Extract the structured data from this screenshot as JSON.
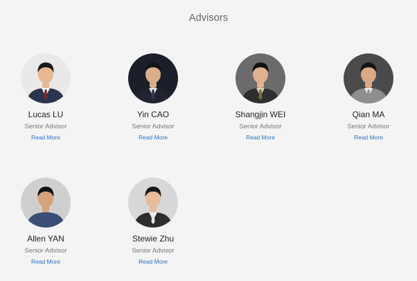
{
  "section": {
    "title": "Advisors"
  },
  "advisors": [
    {
      "name": "Lucas LU",
      "role": "Senior Advisor",
      "link": "Read More",
      "avatar_bg": "#e9e9e9",
      "skin": "#e7b892",
      "hair": "#1b1b1b",
      "suit": "#2a3550",
      "shirt": "#ffffff",
      "tie": "#7a2730"
    },
    {
      "name": "Yin CAO",
      "role": "Senior Advisor",
      "link": "Read More",
      "avatar_bg": "#1b1f2a",
      "skin": "#d9ae8b",
      "hair": "#151515",
      "suit": "#20242f",
      "shirt": "#e6e6e6",
      "tie": "#30384d"
    },
    {
      "name": "Shangjin WEI",
      "role": "Senior Advisor",
      "link": "Read More",
      "avatar_bg": "#6b6b6b",
      "skin": "#e0b18e",
      "hair": "#121212",
      "suit": "#2e2e2e",
      "shirt": "#d9d2b8",
      "tie": "#7a6a3d"
    },
    {
      "name": "Qian MA",
      "role": "Senior Advisor",
      "link": "Read More",
      "avatar_bg": "#4a4a4a",
      "skin": "#d9a985",
      "hair": "#141414",
      "suit": "#8e8e8e",
      "shirt": "#f2f2f2",
      "tie": "#8e8e8e"
    },
    {
      "name": "Allen YAN",
      "role": "Senior Advisor",
      "link": "Read More",
      "avatar_bg": "#cfcfcf",
      "skin": "#d7a17a",
      "hair": "#121212",
      "suit": "#3b4e76",
      "shirt": "#3b4e76",
      "tie": "#3b4e76"
    },
    {
      "name": "Stewie Zhu",
      "role": "Senior Advisor",
      "link": "Read More",
      "avatar_bg": "#d8d8d8",
      "skin": "#e6bc9a",
      "hair": "#181818",
      "suit": "#2d2d2d",
      "shirt": "#f1f1f1",
      "tie": "#e6e6e6"
    }
  ]
}
